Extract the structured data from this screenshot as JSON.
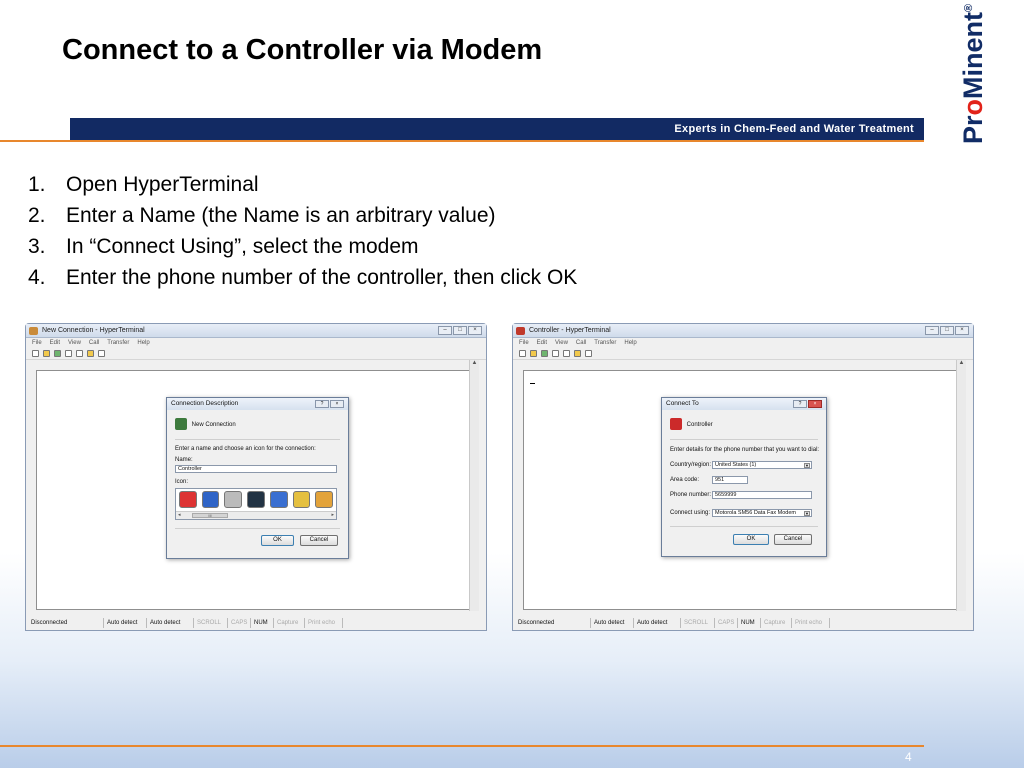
{
  "slide": {
    "title": "Connect to a Controller via Modem",
    "tagline": "Experts in Chem-Feed and Water Treatment",
    "logo_pre": "Pr",
    "logo_o": "o",
    "logo_post": "Minent",
    "logo_reg": "®",
    "page_number": "4",
    "steps": [
      {
        "num": "1.",
        "text": "Open HyperTerminal"
      },
      {
        "num": "2.",
        "text": "Enter a Name (the Name is an arbitrary value)"
      },
      {
        "num": "3.",
        "text": "In “Connect Using”, select the modem"
      },
      {
        "num": "4.",
        "text": "Enter the phone number of the controller, then click OK"
      }
    ]
  },
  "menu": [
    "File",
    "Edit",
    "View",
    "Call",
    "Transfer",
    "Help"
  ],
  "status": {
    "state": "Disconnected",
    "auto1": "Auto detect",
    "auto2": "Auto detect",
    "scroll": "SCROLL",
    "caps": "CAPS",
    "num": "NUM",
    "capture": "Capture",
    "print": "Print echo"
  },
  "window_left": {
    "title": "New Connection - HyperTerminal",
    "dialog": {
      "title": "Connection Description",
      "header": "New Connection",
      "prompt": "Enter a name and choose an icon for the connection:",
      "name_label": "Name:",
      "name_value": "Controller",
      "icon_label": "Icon:",
      "ok": "OK",
      "cancel": "Cancel"
    }
  },
  "window_right": {
    "title": "Controller - HyperTerminal",
    "dialog": {
      "title": "Connect To",
      "header": "Controller",
      "prompt": "Enter details for the phone number that you want to dial:",
      "country_label": "Country/region:",
      "country_value": "United States (1)",
      "area_label": "Area code:",
      "area_value": "951",
      "phone_label": "Phone number:",
      "phone_value": "5659999",
      "connect_label": "Connect using:",
      "connect_value": "Motorola SM56 Data Fax Modem",
      "ok": "OK",
      "cancel": "Cancel"
    }
  }
}
